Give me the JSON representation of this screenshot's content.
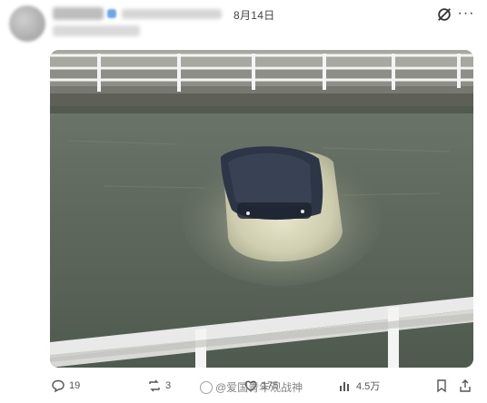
{
  "post": {
    "date": "8月14日"
  },
  "image": {
    "alt_description": "Partially submerged white car in a canal with railings"
  },
  "actions": {
    "replies": "19",
    "reposts": "3",
    "likes": "175",
    "views": "4.5万"
  },
  "watermark": {
    "text": "@爱国青年观战神"
  },
  "icons": {
    "reply": "reply-icon",
    "repost": "repost-icon",
    "like": "like-icon",
    "views": "views-icon",
    "bookmark": "bookmark-icon",
    "share": "share-icon",
    "grok": "grok-icon",
    "more": "more-icon"
  },
  "colors": {
    "text": "#333333",
    "muted": "#555555",
    "water": "#5a6358",
    "railing": "#f4f4f4"
  }
}
